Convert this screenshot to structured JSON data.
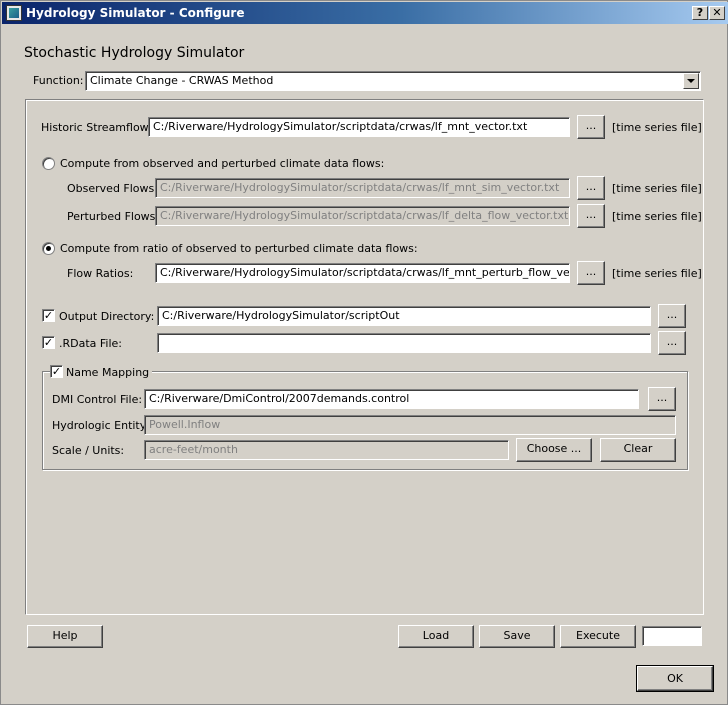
{
  "window": {
    "title": "Hydrology Simulator - Configure",
    "help_glyph": "?",
    "close_glyph": "✕"
  },
  "heading": "Stochastic Hydrology Simulator",
  "function": {
    "label": "Function:",
    "selected": "Climate Change - CRWAS Method"
  },
  "historic": {
    "label": "Historic Streamflows:",
    "value": "C:/Riverware/HydrologySimulator/scriptdata/crwas/lf_mnt_vector.txt",
    "browse": "...",
    "hint": "[time series file]"
  },
  "option_observed": {
    "label": "Compute from observed and perturbed climate data flows:",
    "selected": false,
    "observed_label": "Observed Flows:",
    "observed_value": "C:/Riverware/HydrologySimulator/scriptdata/crwas/lf_mnt_sim_vector.txt",
    "perturbed_label": "Perturbed Flows:",
    "perturbed_value": "C:/Riverware/HydrologySimulator/scriptdata/crwas/lf_delta_flow_vector.txt",
    "browse": "...",
    "hint": "[time series file]"
  },
  "option_ratio": {
    "label": "Compute from ratio of observed to perturbed climate data flows:",
    "selected": true,
    "ratios_label": "Flow Ratios:",
    "ratios_value": "C:/Riverware/HydrologySimulator/scriptdata/crwas/lf_mnt_perturb_flow_vector.txt",
    "browse": "...",
    "hint": "[time series file]"
  },
  "output_directory": {
    "checked": true,
    "label": "Output Directory:",
    "value": "C:/Riverware/HydrologySimulator/scriptOut",
    "browse": "..."
  },
  "rdata_file": {
    "checked": true,
    "label": ".RData File:",
    "value": "",
    "browse": "..."
  },
  "name_mapping": {
    "checked": true,
    "title": "Name Mapping",
    "dmi_label": "DMI Control File:",
    "dmi_value": "C:/Riverware/DmiControl/2007demands.control",
    "browse": "...",
    "entity_label": "Hydrologic Entity:",
    "entity_value": "Powell.Inflow",
    "scale_label": "Scale / Units:",
    "scale_value": "acre-feet/month",
    "choose_label": "Choose ...",
    "clear_label": "Clear"
  },
  "footer": {
    "help": "Help",
    "load": "Load",
    "save": "Save",
    "execute": "Execute",
    "execute_field": "",
    "ok": "OK"
  }
}
